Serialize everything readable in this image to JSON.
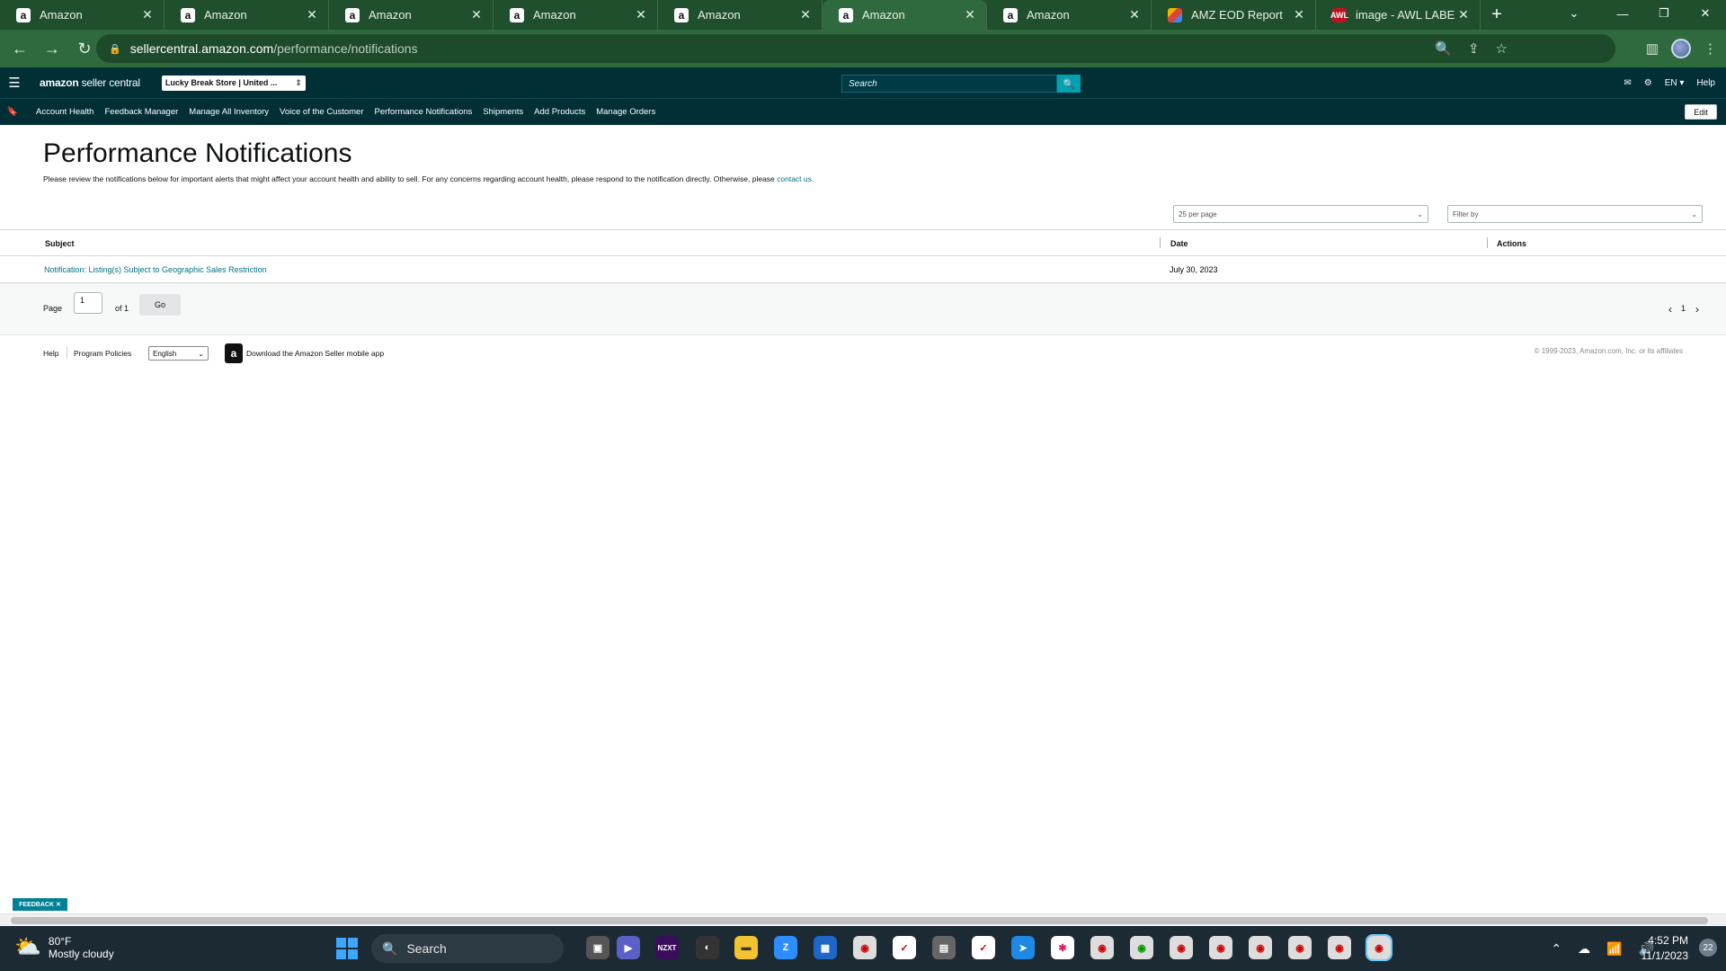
{
  "browser": {
    "tabs": [
      {
        "title": "Amazon",
        "favicon": "a"
      },
      {
        "title": "Amazon",
        "favicon": "a"
      },
      {
        "title": "Amazon",
        "favicon": "a"
      },
      {
        "title": "Amazon",
        "favicon": "a"
      },
      {
        "title": "Amazon",
        "favicon": "a"
      },
      {
        "title": "Amazon",
        "favicon": "a"
      },
      {
        "title": "Amazon",
        "favicon": "a"
      },
      {
        "title": "AMZ EOD Report",
        "favicon": ""
      },
      {
        "title": "image - AWL LABEL",
        "favicon": "AWL"
      }
    ],
    "active_tab_index": 5,
    "url_host": "sellercentral.amazon.com",
    "url_path": "/performance/notifications"
  },
  "header": {
    "logo_brand": "amazon",
    "logo_suffix": " seller central",
    "store_selector": "Lucky Break Store | United ...",
    "search_placeholder": "Search",
    "language": "EN ▾",
    "help": "Help"
  },
  "nav": {
    "links": [
      "Account Health",
      "Feedback Manager",
      "Manage All Inventory",
      "Voice of the Customer",
      "Performance Notifications",
      "Shipments",
      "Add Products",
      "Manage Orders"
    ],
    "edit_label": "Edit"
  },
  "page": {
    "title": "Performance Notifications",
    "description": "Please review the notifications below for important alerts that might affect your account health and ability to sell. For any concerns regarding account health, please respond to the notification directly. Otherwise, please ",
    "contact_link": "contact us",
    "description_end": ".",
    "per_page": "25 per page",
    "filter_placeholder": "Filter by"
  },
  "table": {
    "columns": [
      "Subject",
      "Date",
      "Actions"
    ],
    "rows": [
      {
        "subject": "Notification: Listing(s) Subject to Geographic Sales Restriction",
        "date": "July 30, 2023",
        "actions": ""
      }
    ]
  },
  "pager": {
    "page_label": "Page",
    "page_value": "1",
    "of_label": "of 1",
    "go_label": "Go",
    "prev": "‹",
    "current": "1",
    "next": "›"
  },
  "footer": {
    "help": "Help",
    "program_policies": "Program Policies",
    "language": "English",
    "download_app": "Download the Amazon Seller mobile app",
    "copyright": "© 1999-2023, Amazon.com, Inc. or its affiliates",
    "feedback": "FEEDBACK ✕"
  },
  "taskbar": {
    "temperature": "80°F",
    "weather": "Mostly cloudy",
    "search_label": "Search",
    "time": "4:52 PM",
    "date": "11/1/2023",
    "notification_count": "22"
  },
  "colors": {
    "header_bg": "#002f36",
    "link": "#007185",
    "chrome_green": "#2e6a3e"
  }
}
